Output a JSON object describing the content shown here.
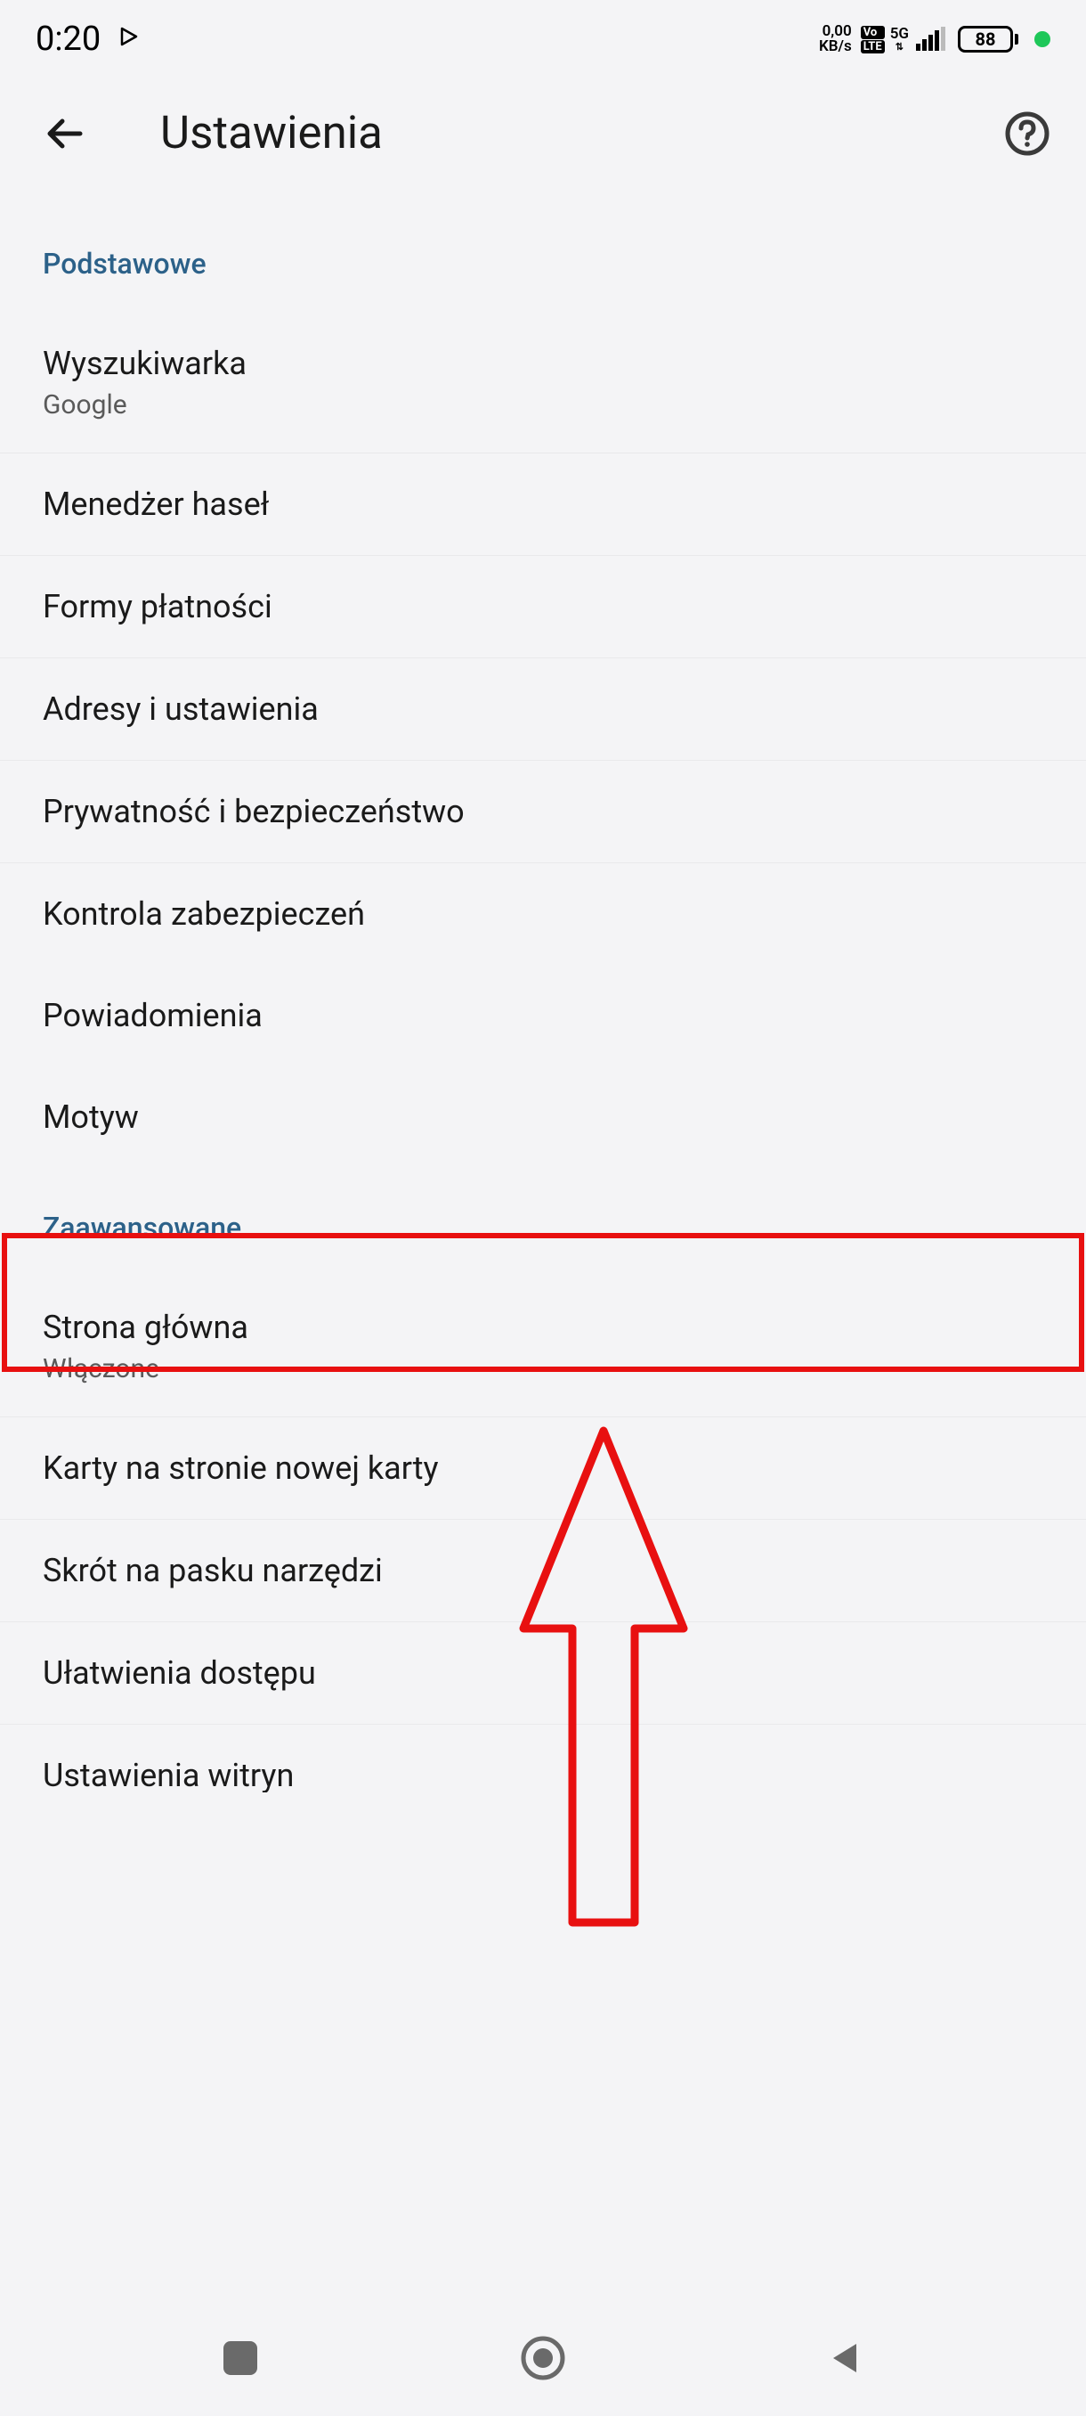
{
  "status_bar": {
    "time": "0:20",
    "data_top": "0,00",
    "data_bottom": "KB/s",
    "net_label": "5G",
    "battery": "88"
  },
  "header": {
    "title": "Ustawienia"
  },
  "sections": {
    "basic": {
      "title": "Podstawowe",
      "items": [
        {
          "title": "Wyszukiwarka",
          "subtitle": "Google"
        },
        {
          "title": "Menedżer haseł"
        },
        {
          "title": "Formy płatności"
        },
        {
          "title": "Adresy i ustawienia"
        },
        {
          "title": "Prywatność i bezpieczeństwo"
        },
        {
          "title": "Kontrola zabezpieczeń"
        },
        {
          "title": "Powiadomienia"
        },
        {
          "title": "Motyw"
        }
      ]
    },
    "advanced": {
      "title": "Zaawansowane",
      "items": [
        {
          "title": "Strona główna",
          "subtitle": "Włączone"
        },
        {
          "title": "Karty na stronie nowej karty"
        },
        {
          "title": "Skrót na pasku narzędzi"
        },
        {
          "title": "Ułatwienia dostępu"
        },
        {
          "title": "Ustawienia witryn"
        }
      ]
    }
  }
}
